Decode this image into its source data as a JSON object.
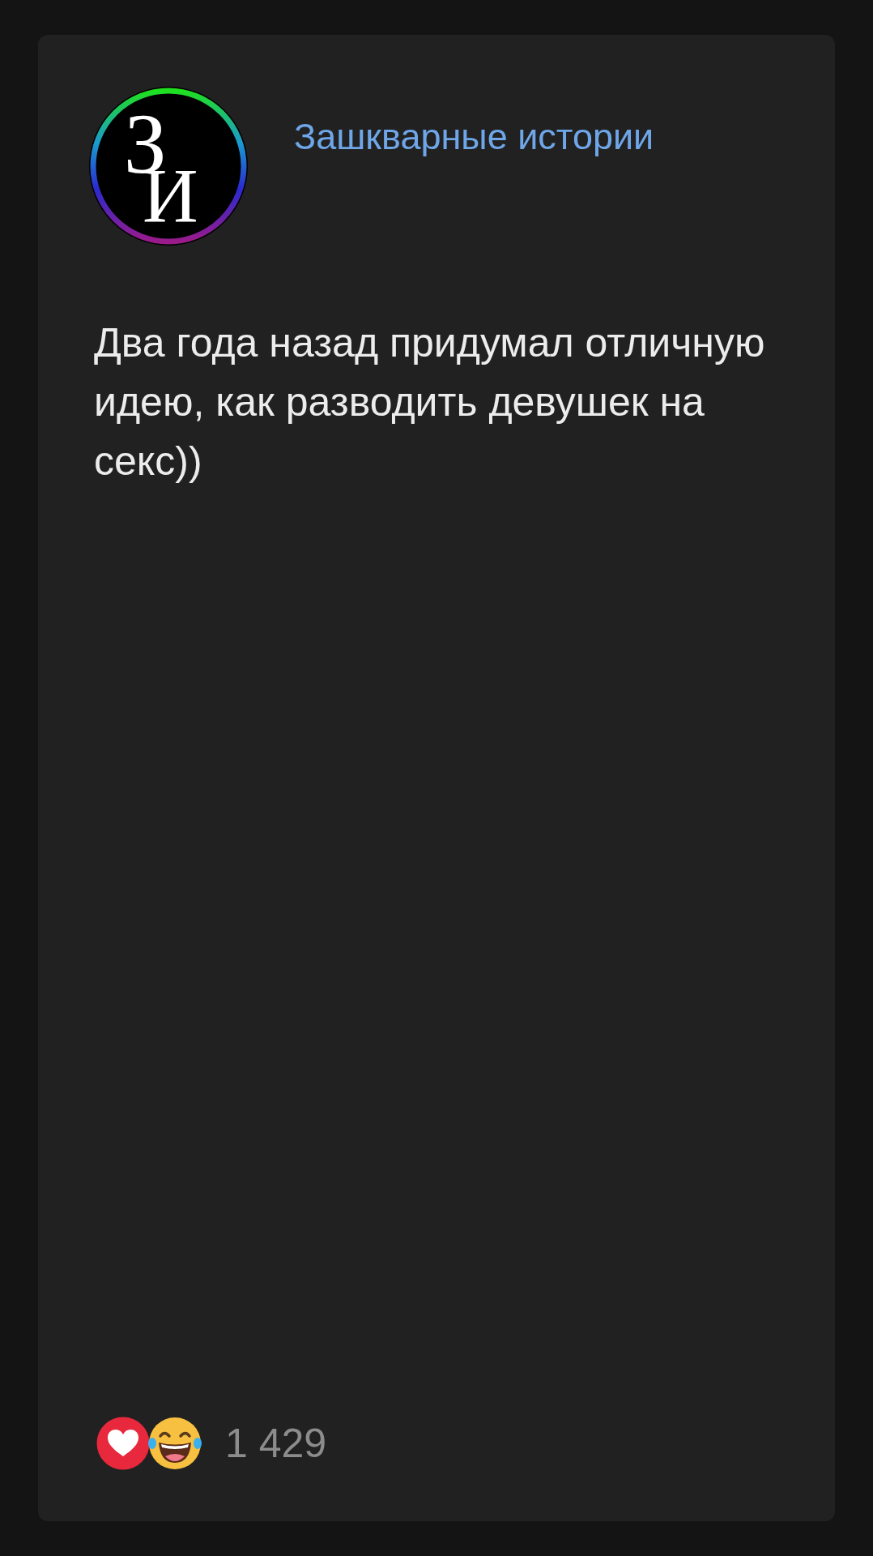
{
  "post": {
    "channel": {
      "logo_letters": [
        "З",
        "И"
      ],
      "name": "Зашкварные истории"
    },
    "text": "Два года назад придумал отличную идею, как разводить девушек на секс))",
    "reactions": [
      {
        "kind": "heart"
      },
      {
        "kind": "laugh"
      }
    ],
    "reaction_count": "1 429"
  }
}
